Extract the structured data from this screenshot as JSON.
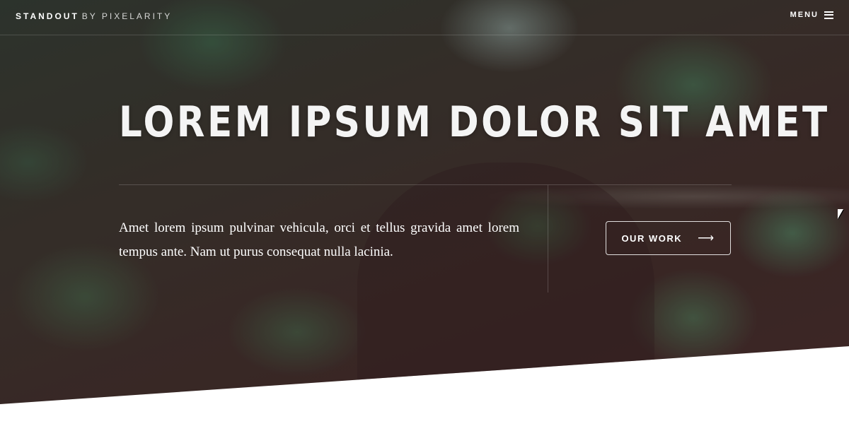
{
  "brand": {
    "name": "STANDOUT",
    "suffix": "BY PIXELARITY"
  },
  "menu": {
    "label": "MENU",
    "icon": "hamburger-icon"
  },
  "hero": {
    "headline": "LOREM IPSUM DOLOR SIT AMET",
    "lead": "Amet lorem ipsum pulvinar vehicula, orci et tellus gravida amet lorem tempus ante. Nam ut purus consequat nulla lacinia.",
    "cta": {
      "label": "OUR WORK",
      "icon": "arrow-right-icon"
    }
  },
  "colors": {
    "text": "#ffffff",
    "below_hero": "#ffffff"
  }
}
